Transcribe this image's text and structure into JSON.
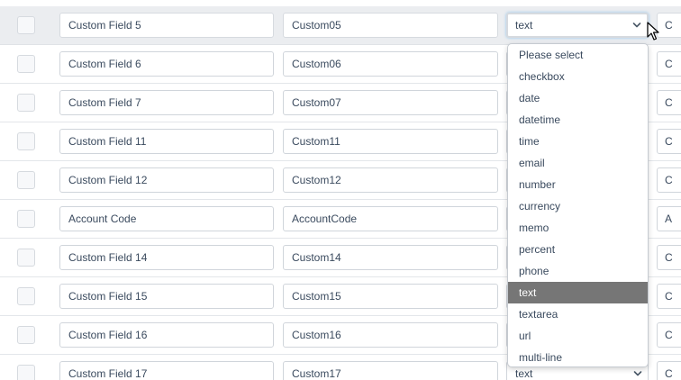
{
  "rows": [
    {
      "name": "Custom Field 5",
      "code": "Custom05",
      "type": "text",
      "stub": "C"
    },
    {
      "name": "Custom Field 6",
      "code": "Custom06",
      "type": "",
      "stub": "C"
    },
    {
      "name": "Custom Field 7",
      "code": "Custom07",
      "type": "",
      "stub": "C"
    },
    {
      "name": "Custom Field 11",
      "code": "Custom11",
      "type": "",
      "stub": "C"
    },
    {
      "name": "Custom Field 12",
      "code": "Custom12",
      "type": "",
      "stub": "C"
    },
    {
      "name": "Account Code",
      "code": "AccountCode",
      "type": "",
      "stub": "A"
    },
    {
      "name": "Custom Field 14",
      "code": "Custom14",
      "type": "",
      "stub": "C"
    },
    {
      "name": "Custom Field 15",
      "code": "Custom15",
      "type": "",
      "stub": "C"
    },
    {
      "name": "Custom Field 16",
      "code": "Custom16",
      "type": "",
      "stub": "C"
    },
    {
      "name": "Custom Field 17",
      "code": "Custom17",
      "type": "text",
      "stub": "C"
    }
  ],
  "dropdown": {
    "options": [
      "Please select",
      "checkbox",
      "date",
      "datetime",
      "time",
      "email",
      "number",
      "currency",
      "memo",
      "percent",
      "phone",
      "text",
      "textarea",
      "url",
      "multi-line"
    ],
    "selected": "text"
  },
  "colors": {
    "selected_option_bg": "#767676",
    "focus_border": "#5aa8e6",
    "text": "#3a4a5e"
  },
  "icons": {
    "select_arrow": "chevron-down-icon",
    "pointer": "mouse-pointer-icon"
  }
}
